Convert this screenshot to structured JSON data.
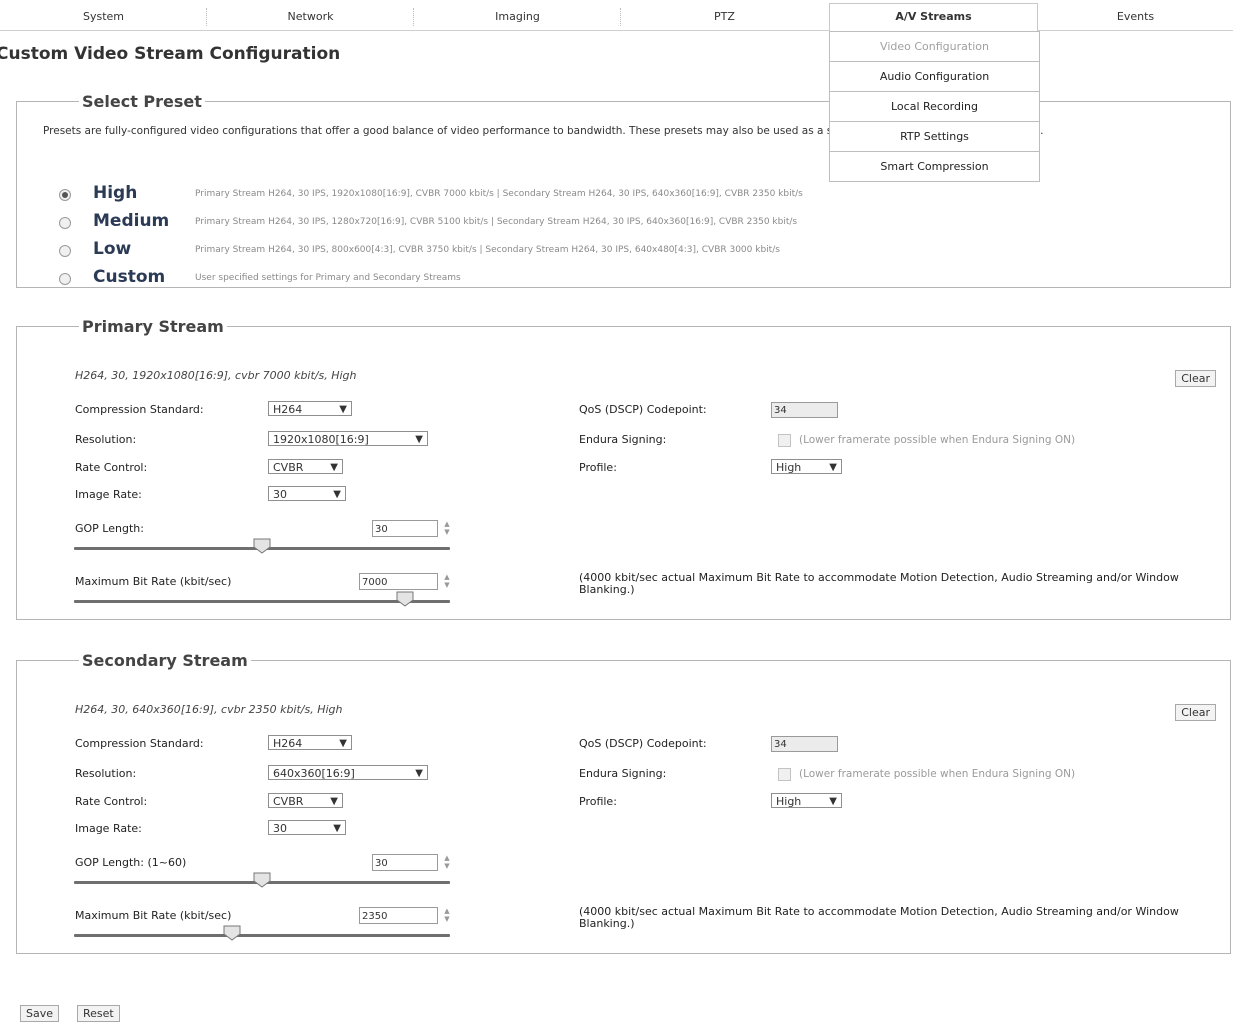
{
  "nav": {
    "tabs": [
      "System",
      "Network",
      "Imaging",
      "PTZ",
      "A/V Streams",
      "Events"
    ],
    "active": "A/V Streams",
    "dropdown": [
      "Video Configuration",
      "Audio Configuration",
      "Local Recording",
      "RTP Settings",
      "Smart Compression"
    ]
  },
  "page_title": "Custom Video Stream Configuration",
  "preset": {
    "legend": "Select Preset",
    "description": "Presets are fully-configured video configurations that offer a good balance of video performance to bandwidth. These presets may also be used as a starting point for a custom configuration.",
    "options": [
      {
        "label": "High",
        "desc": "Primary Stream H264, 30 IPS, 1920x1080[16:9], CVBR 7000 kbit/s | Secondary Stream H264, 30 IPS, 640x360[16:9], CVBR 2350 kbit/s",
        "selected": true
      },
      {
        "label": "Medium",
        "desc": "Primary Stream H264, 30 IPS, 1280x720[16:9], CVBR 5100 kbit/s | Secondary Stream H264, 30 IPS, 640x360[16:9], CVBR 2350 kbit/s",
        "selected": false
      },
      {
        "label": "Low",
        "desc": "Primary Stream H264, 30 IPS, 800x600[4:3], CVBR 3750 kbit/s | Secondary Stream H264, 30 IPS, 640x480[4:3], CVBR 3000 kbit/s",
        "selected": false
      },
      {
        "label": "Custom",
        "desc": "User specified settings for Primary and Secondary Streams",
        "selected": false
      }
    ]
  },
  "primary": {
    "legend": "Primary Stream",
    "summary": "H264, 30, 1920x1080[16:9], cvbr 7000 kbit/s, High",
    "clear": "Clear",
    "compression_label": "Compression Standard:",
    "compression_value": "H264",
    "resolution_label": "Resolution:",
    "resolution_value": "1920x1080[16:9]",
    "rate_control_label": "Rate Control:",
    "rate_control_value": "CVBR",
    "image_rate_label": "Image Rate:",
    "image_rate_value": "30",
    "gop_label": "GOP Length:",
    "gop_value": "30",
    "gop_slider_fraction": 0.5,
    "bitrate_label": "Maximum Bit Rate (kbit/sec)",
    "bitrate_value": "7000",
    "bitrate_slider_fraction": 0.88,
    "qos_label": "QoS (DSCP) Codepoint:",
    "qos_value": "34",
    "endura_label": "Endura Signing:",
    "endura_note": "(Lower framerate possible when Endura Signing ON)",
    "profile_label": "Profile:",
    "profile_value": "High",
    "bitrate_note": "(4000 kbit/sec actual Maximum Bit Rate to accommodate Motion Detection, Audio Streaming and/or Window Blanking.)"
  },
  "secondary": {
    "legend": "Secondary Stream",
    "summary": "H264, 30, 640x360[16:9], cvbr 2350 kbit/s, High",
    "clear": "Clear",
    "compression_label": "Compression Standard:",
    "compression_value": "H264",
    "resolution_label": "Resolution:",
    "resolution_value": "640x360[16:9]",
    "rate_control_label": "Rate Control:",
    "rate_control_value": "CVBR",
    "image_rate_label": "Image Rate:",
    "image_rate_value": "30",
    "gop_label": "GOP Length: (1~60)",
    "gop_value": "30",
    "gop_slider_fraction": 0.5,
    "bitrate_label": "Maximum Bit Rate (kbit/sec)",
    "bitrate_value": "2350",
    "bitrate_slider_fraction": 0.42,
    "qos_label": "QoS (DSCP) Codepoint:",
    "qos_value": "34",
    "endura_label": "Endura Signing:",
    "endura_note": "(Lower framerate possible when Endura Signing ON)",
    "profile_label": "Profile:",
    "profile_value": "High",
    "bitrate_note": "(4000 kbit/sec actual Maximum Bit Rate to accommodate Motion Detection, Audio Streaming and/or Window Blanking.)"
  },
  "footer": {
    "save": "Save",
    "reset": "Reset"
  }
}
